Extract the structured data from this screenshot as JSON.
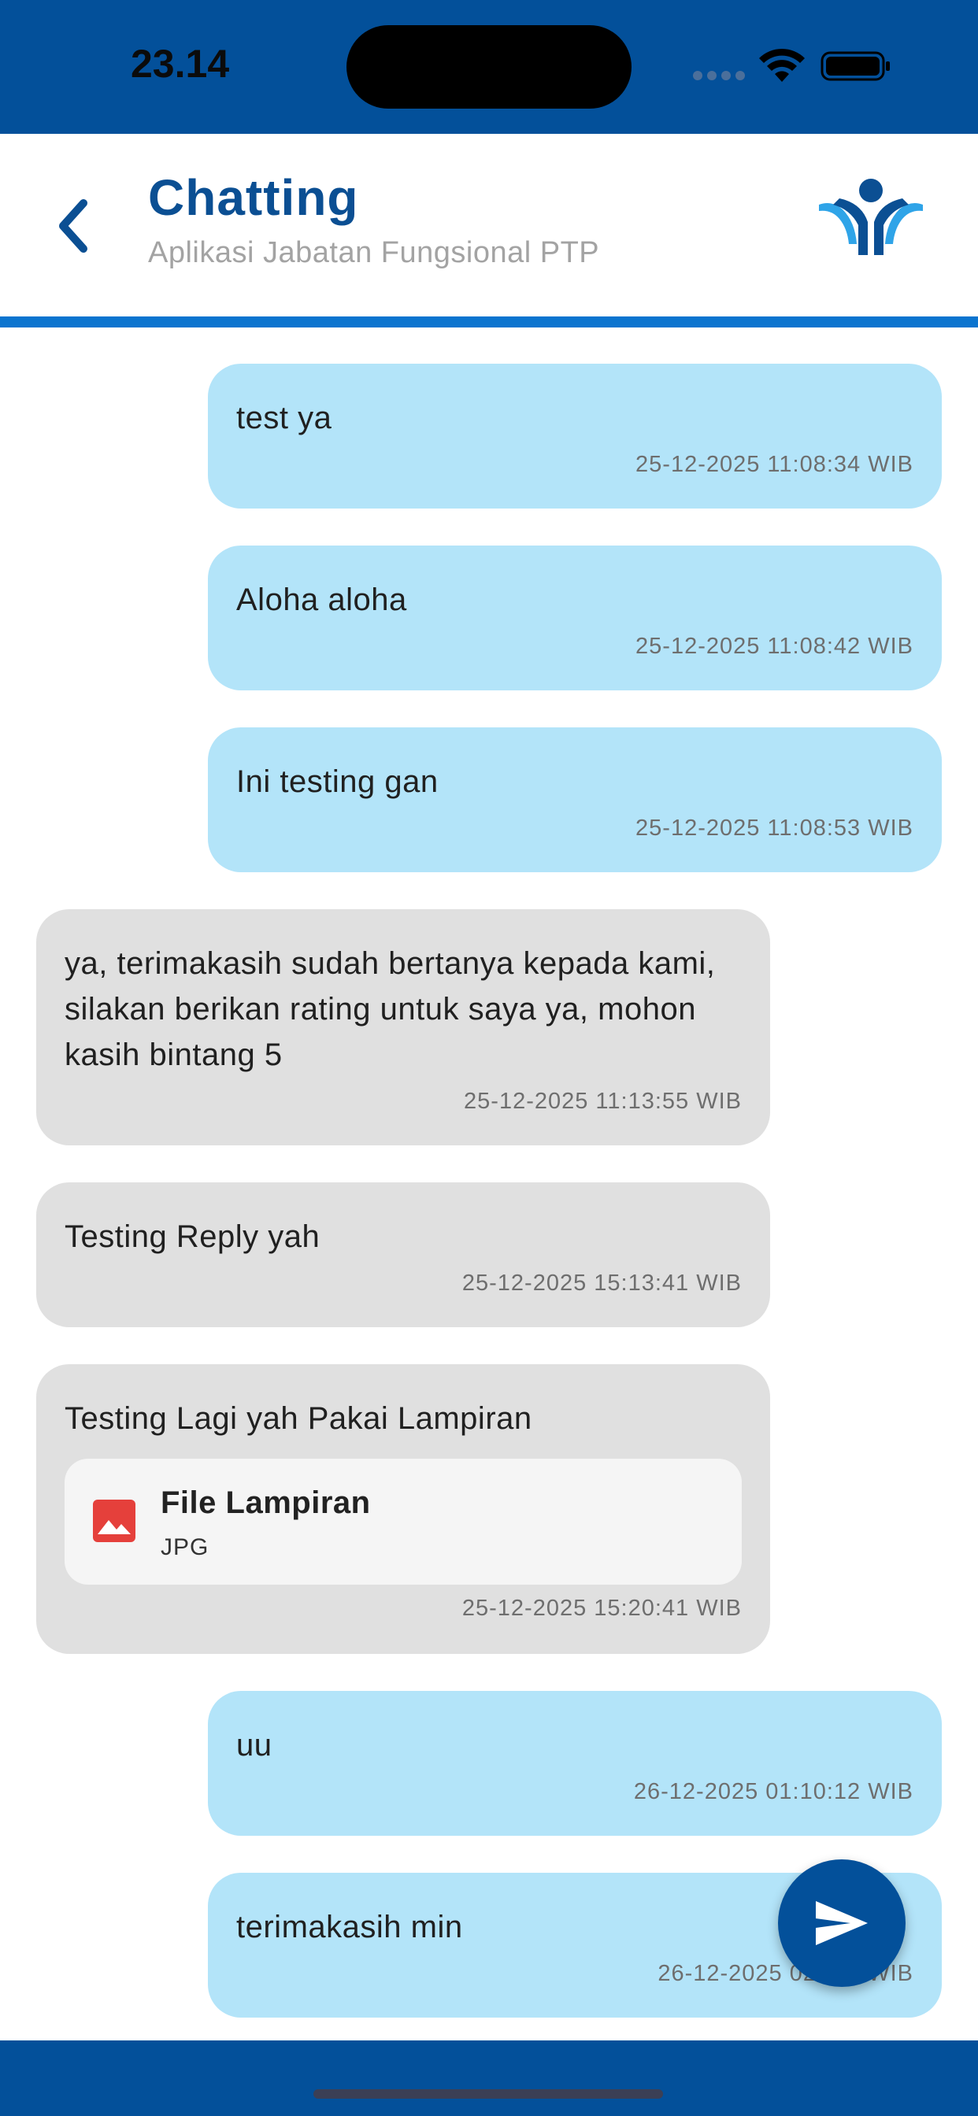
{
  "status_bar": {
    "time": "23.14"
  },
  "header": {
    "title": "Chatting",
    "subtitle": "Aplikasi Jabatan Fungsional PTP",
    "back_icon": "chevron-left-icon",
    "logo_icon": "person-arms-up-logo"
  },
  "colors": {
    "primary": "#03509a",
    "accent": "#0a74cf",
    "outgoing_bubble": "#b3e4f9",
    "incoming_bubble": "#e0e0e0",
    "attachment_icon": "#e5403b"
  },
  "messages": [
    {
      "direction": "out",
      "text": "test ya",
      "time": "25-12-2025 11:08:34 WIB"
    },
    {
      "direction": "out",
      "text": "Aloha aloha",
      "time": "25-12-2025 11:08:42 WIB"
    },
    {
      "direction": "out",
      "text": "Ini testing gan",
      "time": "25-12-2025 11:08:53 WIB"
    },
    {
      "direction": "in",
      "text": "ya, terimakasih sudah bertanya kepada kami, silakan berikan rating untuk saya ya, mohon kasih bintang 5",
      "time": "25-12-2025 11:13:55 WIB"
    },
    {
      "direction": "in",
      "text": "Testing Reply yah",
      "time": "25-12-2025 15:13:41 WIB"
    },
    {
      "direction": "in",
      "text": "Testing Lagi yah Pakai Lampiran",
      "time": "25-12-2025 15:20:41 WIB",
      "attachment": {
        "name": "File Lampiran",
        "type": "JPG",
        "icon": "image-icon"
      }
    },
    {
      "direction": "out",
      "text": "uu",
      "time": "26-12-2025 01:10:12 WIB"
    },
    {
      "direction": "out",
      "text": "terimakasih min",
      "time": "26-12-2025 02:0… WIB"
    }
  ],
  "send_button": {
    "icon": "send-icon"
  }
}
